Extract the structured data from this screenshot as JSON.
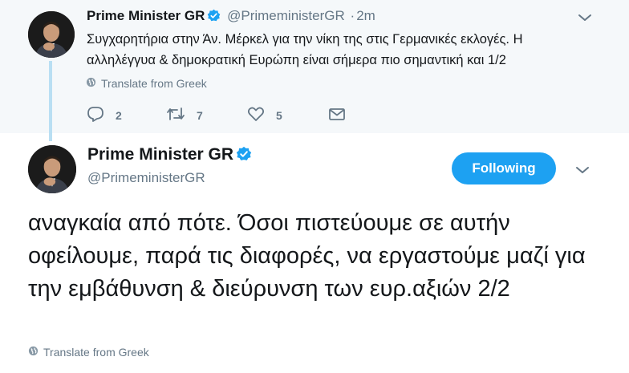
{
  "reply_tweet": {
    "display_name": "Prime Minister GR",
    "handle": "@PrimeministerGR",
    "separator": "·",
    "time": "2m",
    "text": "Συγχαρητήρια στην Άν. Μέρκελ για την νίκη της στις Γερμανικές εκλογές. Η αλληλέγγυα & δημοκρατική Ευρώπη είναι σήμερα πιο σημαντική και 1/2",
    "translate_label": "Translate from Greek",
    "reply_count": "2",
    "retweet_count": "7",
    "like_count": "5",
    "icons": [
      "verified-badge-icon",
      "chevron-down-icon",
      "globe-icon",
      "reply-icon",
      "retweet-icon",
      "heart-icon",
      "envelope-icon"
    ]
  },
  "main_tweet": {
    "display_name": "Prime Minister GR",
    "handle": "@PrimeministerGR",
    "follow_button_label": "Following",
    "text": "αναγκαία από πότε. Όσοι πιστεύουμε σε αυτήν οφείλουμε, παρά τις διαφορές, να εργαστούμε μαζί για την εμβάθυνση & διεύρυνση των ευρ.αξιών 2/2",
    "translate_label": "Translate from Greek"
  },
  "colors": {
    "accent": "#1da1f2",
    "secondary_text": "#657786",
    "thread_line": "#b9dff3",
    "reply_background": "#f5f8fa"
  }
}
